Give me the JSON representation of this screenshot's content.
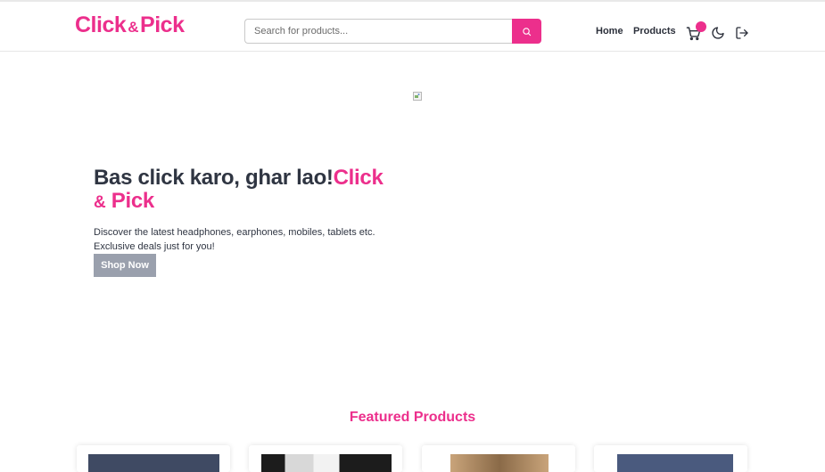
{
  "header": {
    "logo_left": "Click",
    "logo_amp": "&",
    "logo_right": "Pick",
    "search": {
      "placeholder": "Search for products..."
    },
    "nav": {
      "home": "Home",
      "products": "Products"
    },
    "icons": [
      "search-icon",
      "cart-icon",
      "moon-icon",
      "logout-icon"
    ]
  },
  "hero": {
    "title_plain": "Bas click karo, ghar lao!",
    "title_brand_1": "Click",
    "title_brand_amp": "&",
    "title_brand_2": "Pick",
    "line1": "Discover the latest headphones, earphones, mobiles, tablets etc.",
    "line2": "Exclusive deals just for you!",
    "cta": "Shop Now"
  },
  "featured": {
    "title": "Featured Products",
    "cards": [
      {
        "color": "#3f4a63"
      },
      {
        "color": "#1c1c1c"
      },
      {
        "color": "#c9a47a"
      },
      {
        "color": "#4a5a7e"
      }
    ]
  },
  "colors": {
    "accent": "#ec2f8c",
    "text": "#2f3542",
    "button_gray": "#9aa0ad"
  }
}
